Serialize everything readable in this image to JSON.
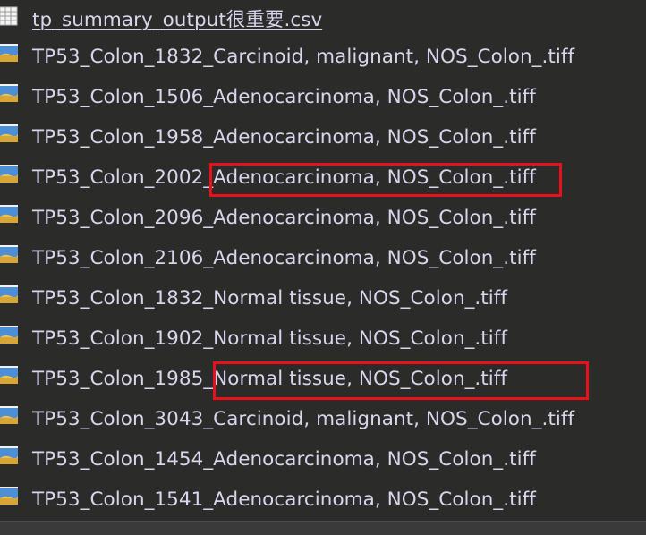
{
  "files": [
    {
      "name": "tp_summary_output很重要.csv",
      "type": "csv",
      "icon": "spreadsheet-icon"
    },
    {
      "name": "TP53_Colon_1832_Carcinoid, malignant, NOS_Colon_.tiff",
      "type": "tiff",
      "icon": "image-file-icon"
    },
    {
      "name": "TP53_Colon_1506_Adenocarcinoma, NOS_Colon_.tiff",
      "type": "tiff",
      "icon": "image-file-icon"
    },
    {
      "name": "TP53_Colon_1958_Adenocarcinoma, NOS_Colon_.tiff",
      "type": "tiff",
      "icon": "image-file-icon"
    },
    {
      "name": "TP53_Colon_2002_Adenocarcinoma, NOS_Colon_.tiff",
      "type": "tiff",
      "icon": "image-file-icon"
    },
    {
      "name": "TP53_Colon_2096_Adenocarcinoma, NOS_Colon_.tiff",
      "type": "tiff",
      "icon": "image-file-icon"
    },
    {
      "name": "TP53_Colon_2106_Adenocarcinoma, NOS_Colon_.tiff",
      "type": "tiff",
      "icon": "image-file-icon"
    },
    {
      "name": "TP53_Colon_1832_Normal tissue, NOS_Colon_.tiff",
      "type": "tiff",
      "icon": "image-file-icon"
    },
    {
      "name": "TP53_Colon_1902_Normal tissue, NOS_Colon_.tiff",
      "type": "tiff",
      "icon": "image-file-icon"
    },
    {
      "name": "TP53_Colon_1985_Normal tissue, NOS_Colon_.tiff",
      "type": "tiff",
      "icon": "image-file-icon"
    },
    {
      "name": "TP53_Colon_3043_Carcinoid, malignant, NOS_Colon_.tiff",
      "type": "tiff",
      "icon": "image-file-icon"
    },
    {
      "name": "TP53_Colon_1454_Adenocarcinoma, NOS_Colon_.tiff",
      "type": "tiff",
      "icon": "image-file-icon"
    },
    {
      "name": "TP53_Colon_1541_Adenocarcinoma, NOS_Colon_.tiff",
      "type": "tiff",
      "icon": "image-file-icon"
    }
  ],
  "annotations": {
    "highlight_color": "#e8111b",
    "highlighted_files": [
      4,
      9
    ]
  },
  "colors": {
    "background": "#2b2b29",
    "text": "#d8d5ec"
  }
}
